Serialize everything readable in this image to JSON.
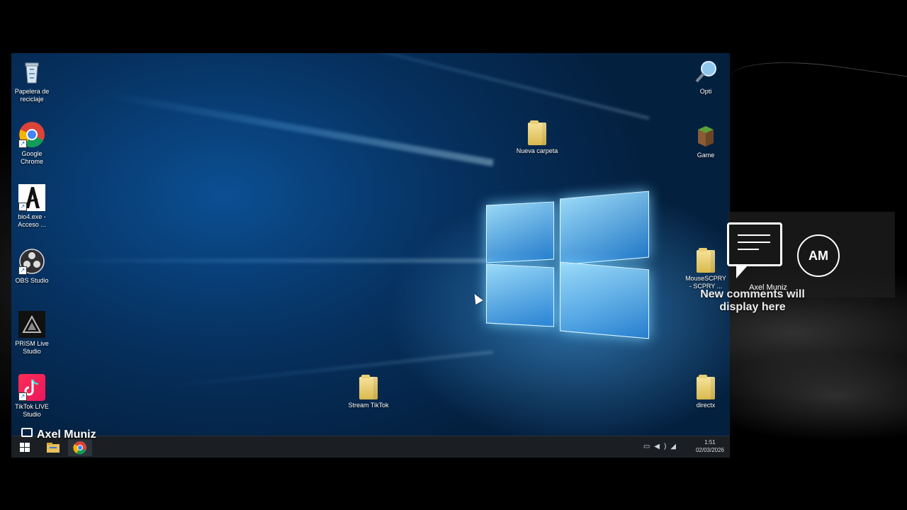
{
  "desktop": {
    "icons_left": [
      {
        "label": "Papelera de reciclaje",
        "icon": "recycle-bin-icon"
      },
      {
        "label": "Google Chrome",
        "icon": "chrome-icon"
      },
      {
        "label": "bio4.exe - Acceso ...",
        "icon": "bio4-icon"
      },
      {
        "label": "OBS Studio",
        "icon": "obs-icon"
      },
      {
        "label": "PRISM Live Studio",
        "icon": "prism-icon"
      },
      {
        "label": "TikTok LIVE Studio",
        "icon": "tiktok-icon"
      }
    ],
    "icons_other": [
      {
        "label": "Opti",
        "icon": "magnifier-icon"
      },
      {
        "label": "Nueva carpeta",
        "icon": "folder-icon"
      },
      {
        "label": "Game",
        "icon": "minecraft-block-icon"
      },
      {
        "label": "MouseSCPRY - SCPRY ...",
        "icon": "folder-icon"
      },
      {
        "label": "Stream TikTok",
        "icon": "folder-icon"
      },
      {
        "label": "directx",
        "icon": "folder-icon"
      }
    ]
  },
  "taskbar": {
    "buttons": [
      {
        "name": "start-button",
        "icon": "windows-logo-icon"
      },
      {
        "name": "file-explorer-button",
        "icon": "file-explorer-icon"
      },
      {
        "name": "chrome-taskbar-button",
        "icon": "chrome-icon"
      }
    ],
    "tray_icons": [
      "battery-icon",
      "volume-icon",
      "network-icon"
    ],
    "time": "1:51",
    "date": "02/03/2026"
  },
  "overlay": {
    "streamer_name": "Axel Muniz",
    "comments_panel": {
      "avatar_initials": "AM",
      "user_name": "Axel Muniz",
      "placeholder": "New comments will display here"
    }
  },
  "colors": {
    "desktop_blue": "#0b4f93",
    "taskbar": "#1b1f24",
    "panel": "#1e1e1e"
  }
}
